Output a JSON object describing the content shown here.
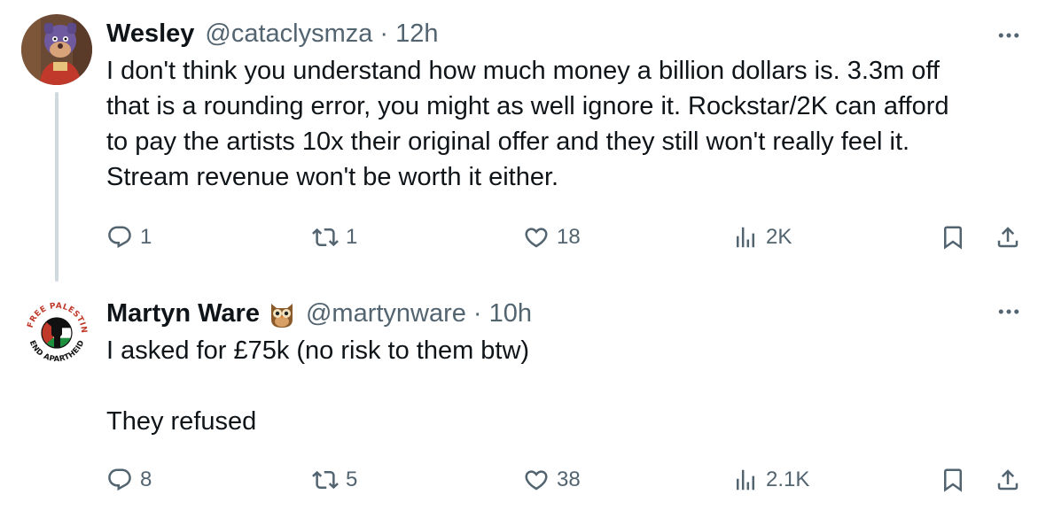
{
  "tweets": [
    {
      "display_name": "Wesley",
      "handle": "@cataclysmza",
      "separator": "·",
      "time": "12h",
      "text": "I don't think you understand how much money a billion dollars is. 3.3m off\nthat is a rounding error, you might as well ignore it. Rockstar/2K can afford\nto pay the artists 10x their original offer and they still won't really feel it.\nStream revenue won't be worth it either.",
      "avatar_icon": "cartoon-character-avatar",
      "stats": {
        "replies": "1",
        "reposts": "1",
        "likes": "18",
        "views": "2K"
      }
    },
    {
      "display_name": "Martyn Ware",
      "name_emoji": "owl",
      "handle": "@martynware",
      "separator": "·",
      "time": "10h",
      "text": "I asked for £75k (no risk to them btw)\n\nThey refused",
      "avatar_icon": "free-palestine-badge-avatar",
      "avatar_text_top": "FREE PALESTINE",
      "avatar_text_bottom": "END APARTHEID",
      "stats": {
        "replies": "8",
        "reposts": "5",
        "likes": "38",
        "views": "2.1K"
      }
    }
  ],
  "colors": {
    "text": "#0f1419",
    "secondary": "#536471",
    "thread_line": "#cfd9de"
  },
  "icons": [
    "reply-icon",
    "repost-icon",
    "like-icon",
    "views-icon",
    "bookmark-icon",
    "share-icon",
    "more-icon"
  ]
}
